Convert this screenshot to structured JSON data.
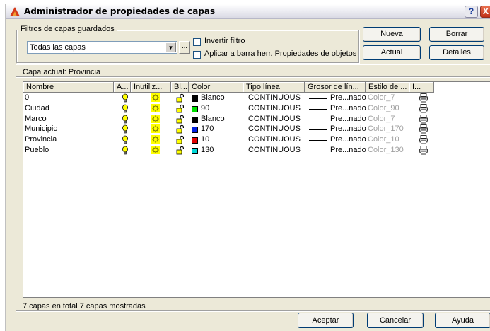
{
  "window": {
    "title": "Administrador de propiedades de capas",
    "help_glyph": "?",
    "close_glyph": "X"
  },
  "filters": {
    "group_label": "Filtros de capas guardados",
    "selected": "Todas las capas",
    "browse_label": "...",
    "invert_label": "Invertir filtro",
    "invert_checked": false,
    "apply_label": "Aplicar a barra herr. Propiedades de objetos",
    "apply_checked": false
  },
  "buttons": {
    "new": "Nueva",
    "delete": "Borrar",
    "current": "Actual",
    "details": "Detalles",
    "ok": "Aceptar",
    "cancel": "Cancelar",
    "help": "Ayuda"
  },
  "current_layer": "Capa actual:  Provincia",
  "columns": [
    "Nombre",
    "A...",
    "Inutiliz...",
    "Bl...",
    "Color",
    "Tipo línea",
    "Grosor de lín...",
    "Estilo de ...",
    "I..."
  ],
  "icons": {
    "on": "lightbulb-on-icon",
    "freeze": "sun-thawed-icon",
    "lock": "unlocked-padlock-icon",
    "plot": "printer-icon"
  },
  "layers": [
    {
      "name": "0",
      "color_name": "Blanco",
      "color_hex": "#000000",
      "linetype": "CONTINUOUS",
      "lineweight": "Pre...nado",
      "plot_style": "Color_7"
    },
    {
      "name": "Ciudad",
      "color_name": "90",
      "color_hex": "#00e000",
      "linetype": "CONTINUOUS",
      "lineweight": "Pre...nado",
      "plot_style": "Color_90"
    },
    {
      "name": "Marco",
      "color_name": "Blanco",
      "color_hex": "#000000",
      "linetype": "CONTINUOUS",
      "lineweight": "Pre...nado",
      "plot_style": "Color_7"
    },
    {
      "name": "Municipio",
      "color_name": "170",
      "color_hex": "#0020e0",
      "linetype": "CONTINUOUS",
      "lineweight": "Pre...nado",
      "plot_style": "Color_170"
    },
    {
      "name": "Provincia",
      "color_name": "10",
      "color_hex": "#e00000",
      "linetype": "CONTINUOUS",
      "lineweight": "Pre...nado",
      "plot_style": "Color_10"
    },
    {
      "name": "Pueblo",
      "color_name": "130",
      "color_hex": "#00d8d8",
      "linetype": "CONTINUOUS",
      "lineweight": "Pre...nado",
      "plot_style": "Color_130"
    }
  ],
  "status": "7 capas en total 7 capas mostradas"
}
